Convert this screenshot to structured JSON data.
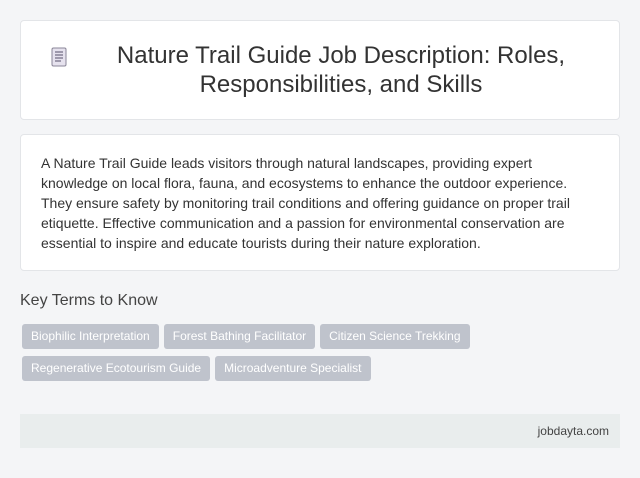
{
  "header": {
    "icon": "document-icon",
    "title": "Nature Trail Guide Job Description: Roles, Responsibilities, and Skills"
  },
  "description": {
    "text": "A Nature Trail Guide leads visitors through natural landscapes, providing expert knowledge on local flora, fauna, and ecosystems to enhance the outdoor experience. They ensure safety by monitoring trail conditions and offering guidance on proper trail etiquette. Effective communication and a passion for environmental conservation are essential to inspire and educate tourists during their nature exploration."
  },
  "key_terms": {
    "heading": "Key Terms to Know",
    "rows": [
      [
        "Biophilic Interpretation",
        "Forest Bathing Facilitator",
        "Citizen Science Trekking"
      ],
      [
        "Regenerative Ecotourism Guide",
        "Microadventure Specialist"
      ]
    ]
  },
  "footer": {
    "site": "jobdayta.com"
  },
  "colors": {
    "background": "#f4f5f7",
    "card": "#ffffff",
    "tag": "#bfc3cc",
    "footer": "#e9eded"
  }
}
